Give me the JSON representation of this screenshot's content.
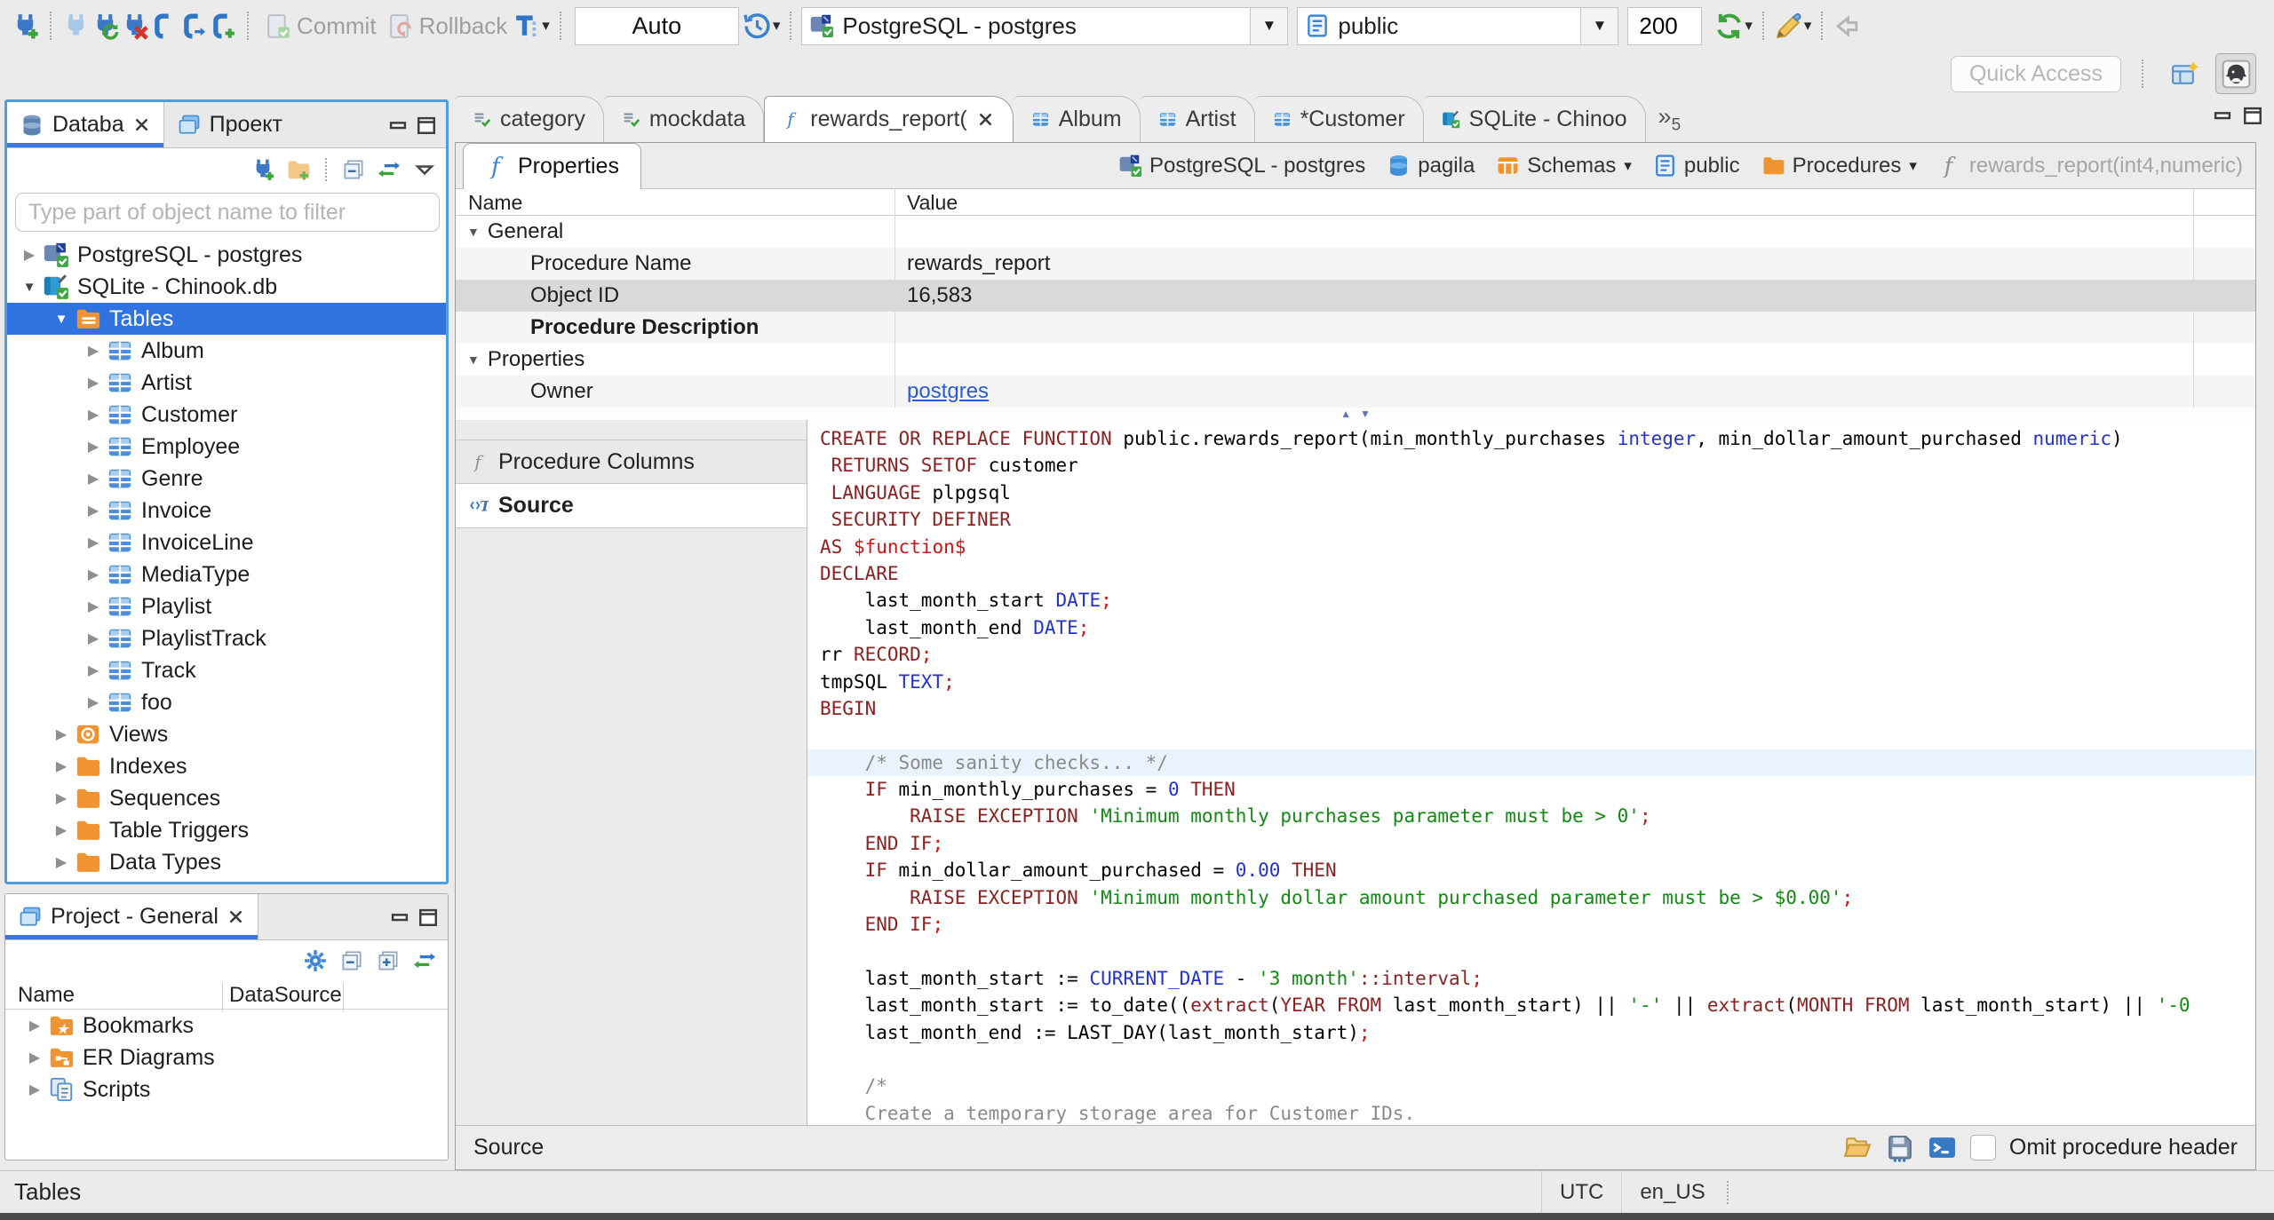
{
  "app": {
    "quick_access_placeholder": "Quick Access"
  },
  "colors": {
    "selection": "#2e73e0",
    "focus_border": "#4f9ddb",
    "keyword": "#8b2121",
    "string": "#128912",
    "number": "#2233cc",
    "semicolon": "#d11313",
    "comment": "#8a8a8a",
    "line_highlight": "#e9f3fd"
  },
  "toolbar": {
    "commit_label": "Commit",
    "rollback_label": "Rollback",
    "auto_mode": "Auto",
    "connection": "PostgreSQL - postgres",
    "schema": "public",
    "fetch_size": "200"
  },
  "navigator": {
    "tab_database": "Databa",
    "tab_project": "Проект",
    "filter_placeholder": "Type part of object name to filter",
    "tree": [
      {
        "label": "PostgreSQL - postgres",
        "icon": "db-postgres",
        "level": 0,
        "state": "collapsed"
      },
      {
        "label": "SQLite - Chinook.db",
        "icon": "db-sqlite",
        "level": 0,
        "state": "expanded"
      },
      {
        "label": "Tables",
        "icon": "folder-tables",
        "level": 1,
        "state": "expanded",
        "selected": true
      },
      {
        "label": "Album",
        "icon": "table",
        "level": 2,
        "state": "collapsed"
      },
      {
        "label": "Artist",
        "icon": "table",
        "level": 2,
        "state": "collapsed"
      },
      {
        "label": "Customer",
        "icon": "table",
        "level": 2,
        "state": "collapsed"
      },
      {
        "label": "Employee",
        "icon": "table",
        "level": 2,
        "state": "collapsed"
      },
      {
        "label": "Genre",
        "icon": "table",
        "level": 2,
        "state": "collapsed"
      },
      {
        "label": "Invoice",
        "icon": "table",
        "level": 2,
        "state": "collapsed"
      },
      {
        "label": "InvoiceLine",
        "icon": "table",
        "level": 2,
        "state": "collapsed"
      },
      {
        "label": "MediaType",
        "icon": "table",
        "level": 2,
        "state": "collapsed"
      },
      {
        "label": "Playlist",
        "icon": "table",
        "level": 2,
        "state": "collapsed"
      },
      {
        "label": "PlaylistTrack",
        "icon": "table",
        "level": 2,
        "state": "collapsed"
      },
      {
        "label": "Track",
        "icon": "table",
        "level": 2,
        "state": "collapsed"
      },
      {
        "label": "foo",
        "icon": "table",
        "level": 2,
        "state": "collapsed"
      },
      {
        "label": "Views",
        "icon": "views",
        "level": 1,
        "state": "collapsed"
      },
      {
        "label": "Indexes",
        "icon": "folder",
        "level": 1,
        "state": "collapsed"
      },
      {
        "label": "Sequences",
        "icon": "folder",
        "level": 1,
        "state": "collapsed"
      },
      {
        "label": "Table Triggers",
        "icon": "folder",
        "level": 1,
        "state": "collapsed"
      },
      {
        "label": "Data Types",
        "icon": "folder",
        "level": 1,
        "state": "collapsed"
      }
    ]
  },
  "project_panel": {
    "title": "Project - General",
    "columns": [
      "Name",
      "DataSource"
    ],
    "items": [
      {
        "label": "Bookmarks",
        "icon": "folder-star"
      },
      {
        "label": "ER Diagrams",
        "icon": "folder-er"
      },
      {
        "label": "Scripts",
        "icon": "scripts"
      }
    ]
  },
  "editor_tabs": {
    "overflow_count": "5",
    "tabs": [
      {
        "label": "category",
        "icon": "script"
      },
      {
        "label": "mockdata",
        "icon": "script"
      },
      {
        "label": "rewards_report(",
        "icon": "fn-blue",
        "active": true,
        "closable": true
      },
      {
        "label": "Album",
        "icon": "table"
      },
      {
        "label": "Artist",
        "icon": "table"
      },
      {
        "label": "*Customer",
        "icon": "table"
      },
      {
        "label": "SQLite - Chinoo",
        "icon": "db-sqlite"
      }
    ]
  },
  "properties_view": {
    "tab_label": "Properties",
    "breadcrumb": [
      {
        "label": "PostgreSQL - postgres",
        "icon": "db-postgres"
      },
      {
        "label": "pagila",
        "icon": "db-blue"
      },
      {
        "label": "Schemas",
        "icon": "schemas",
        "caret": true
      },
      {
        "label": "public",
        "icon": "schema"
      },
      {
        "label": "Procedures",
        "icon": "folder",
        "caret": true
      },
      {
        "label": "rewards_report(int4,numeric)",
        "icon": "fn-gray",
        "dim": true
      }
    ],
    "grid_columns": [
      "Name",
      "Value"
    ],
    "rows": [
      {
        "type": "group",
        "label": "General"
      },
      {
        "type": "prop",
        "label": "Procedure Name",
        "value": "rewards_report",
        "alt": true
      },
      {
        "type": "prop",
        "label": "Object ID",
        "value": "16,583",
        "selected": true
      },
      {
        "type": "prop",
        "label": "Procedure Description",
        "value": "",
        "bold": true,
        "alt": true
      },
      {
        "type": "group",
        "label": "Properties"
      },
      {
        "type": "prop",
        "label": "Owner",
        "value": "postgres",
        "link": true,
        "alt": true
      }
    ],
    "subtabs": [
      {
        "label": "Procedure Columns",
        "icon": "fn-gray"
      },
      {
        "label": "Source",
        "icon": "srccode",
        "active": true
      }
    ]
  },
  "source_editor": {
    "lines": [
      {
        "seg": [
          [
            "CREATE OR REPLACE FUNCTION",
            "kw"
          ],
          [
            " public.rewards_report(min_monthly_purchases ",
            "pl"
          ],
          [
            "integer",
            "ty"
          ],
          [
            ", min_dollar_amount_purchased ",
            "pl"
          ],
          [
            "numeric",
            "ty"
          ],
          [
            ")",
            "pl"
          ]
        ]
      },
      {
        "seg": [
          [
            " RETURNS SETOF",
            "kw"
          ],
          [
            " customer",
            "pl"
          ]
        ]
      },
      {
        "seg": [
          [
            " LANGUAGE",
            "kw"
          ],
          [
            " plpgsql",
            "pl"
          ]
        ]
      },
      {
        "seg": [
          [
            " SECURITY DEFINER",
            "kw"
          ]
        ]
      },
      {
        "seg": [
          [
            "AS ",
            "kw"
          ],
          [
            "$function$",
            "rd"
          ]
        ]
      },
      {
        "seg": [
          [
            "DECLARE",
            "kw"
          ]
        ]
      },
      {
        "seg": [
          [
            "    last_month_start ",
            "pl"
          ],
          [
            "DATE",
            "ty"
          ],
          [
            ";",
            "rd"
          ]
        ]
      },
      {
        "seg": [
          [
            "    last_month_end ",
            "pl"
          ],
          [
            "DATE",
            "ty"
          ],
          [
            ";",
            "rd"
          ]
        ]
      },
      {
        "seg": [
          [
            "rr ",
            "pl"
          ],
          [
            "RECORD",
            "kw"
          ],
          [
            ";",
            "rd"
          ]
        ]
      },
      {
        "seg": [
          [
            "tmpSQL ",
            "pl"
          ],
          [
            "TEXT",
            "ty"
          ],
          [
            ";",
            "rd"
          ]
        ]
      },
      {
        "seg": [
          [
            "BEGIN",
            "kw"
          ]
        ]
      },
      {
        "seg": []
      },
      {
        "hl": true,
        "seg": [
          [
            "    /* Some sanity checks... */",
            "co"
          ]
        ]
      },
      {
        "seg": [
          [
            "    IF",
            "kw"
          ],
          [
            " min_monthly_purchases = ",
            "pl"
          ],
          [
            "0",
            "nu"
          ],
          [
            " THEN",
            "kw"
          ]
        ]
      },
      {
        "seg": [
          [
            "        RAISE EXCEPTION ",
            "kw"
          ],
          [
            "'Minimum monthly purchases parameter must be > 0'",
            "st"
          ],
          [
            ";",
            "rd"
          ]
        ]
      },
      {
        "seg": [
          [
            "    END IF",
            "kw"
          ],
          [
            ";",
            "rd"
          ]
        ]
      },
      {
        "seg": [
          [
            "    IF",
            "kw"
          ],
          [
            " min_dollar_amount_purchased = ",
            "pl"
          ],
          [
            "0.00",
            "nu"
          ],
          [
            " THEN",
            "kw"
          ]
        ]
      },
      {
        "seg": [
          [
            "        RAISE EXCEPTION ",
            "kw"
          ],
          [
            "'Minimum monthly dollar amount purchased parameter must be > $0.00'",
            "st"
          ],
          [
            ";",
            "rd"
          ]
        ]
      },
      {
        "seg": [
          [
            "    END IF",
            "kw"
          ],
          [
            ";",
            "rd"
          ]
        ]
      },
      {
        "seg": []
      },
      {
        "seg": [
          [
            "    last_month_start := ",
            "pl"
          ],
          [
            "CURRENT_DATE",
            "ty"
          ],
          [
            " - ",
            "pl"
          ],
          [
            "'3 month'",
            "st"
          ],
          [
            "::interval",
            "kw"
          ],
          [
            ";",
            "rd"
          ]
        ]
      },
      {
        "seg": [
          [
            "    last_month_start := to_date((",
            "pl"
          ],
          [
            "extract",
            "kw"
          ],
          [
            "(",
            "pl"
          ],
          [
            "YEAR FROM",
            "kw"
          ],
          [
            " last_month_start) || ",
            "pl"
          ],
          [
            "'-'",
            "st"
          ],
          [
            " || ",
            "pl"
          ],
          [
            "extract",
            "kw"
          ],
          [
            "(",
            "pl"
          ],
          [
            "MONTH FROM",
            "kw"
          ],
          [
            " last_month_start) || ",
            "pl"
          ],
          [
            "'-0",
            "st"
          ]
        ]
      },
      {
        "seg": [
          [
            "    last_month_end := LAST_DAY(last_month_start)",
            "pl"
          ],
          [
            ";",
            "rd"
          ]
        ]
      },
      {
        "seg": []
      },
      {
        "seg": [
          [
            "    /*",
            "co"
          ]
        ]
      },
      {
        "seg": [
          [
            "    Create a temporary storage area for Customer IDs.",
            "co"
          ]
        ]
      },
      {
        "seg": [
          [
            "    */",
            "co"
          ]
        ]
      }
    ]
  },
  "editor_footer": {
    "label": "Source",
    "omit_label": "Omit procedure header"
  },
  "status_bar": {
    "left": "Tables",
    "timezone": "UTC",
    "locale": "en_US"
  }
}
